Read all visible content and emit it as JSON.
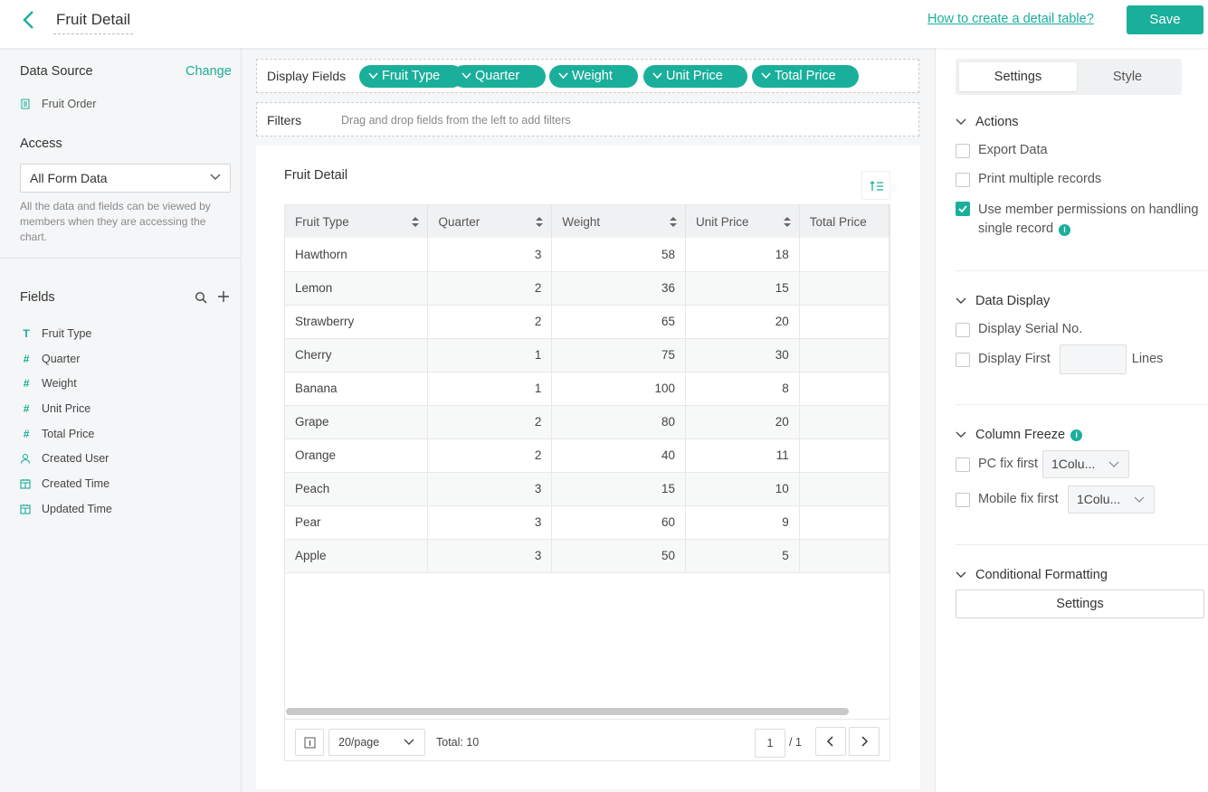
{
  "header": {
    "title": "Fruit Detail",
    "help_link": "How to create a detail table?",
    "save_label": "Save"
  },
  "left": {
    "data_source_label": "Data Source",
    "change_label": "Change",
    "source_name": "Fruit Order",
    "access_label": "Access",
    "access_value": "All Form Data",
    "access_desc": "All the data and fields can be viewed by members when they are accessing the chart.",
    "fields_label": "Fields",
    "fields": [
      {
        "label": "Fruit Type",
        "icon": "text-type-icon",
        "glyph": "T"
      },
      {
        "label": "Quarter",
        "icon": "number-type-icon",
        "glyph": "#"
      },
      {
        "label": "Weight",
        "icon": "number-type-icon",
        "glyph": "#"
      },
      {
        "label": "Unit Price",
        "icon": "number-type-icon",
        "glyph": "#"
      },
      {
        "label": "Total Price",
        "icon": "number-type-icon",
        "glyph": "#"
      },
      {
        "label": "Created User",
        "icon": "user-icon",
        "glyph": ""
      },
      {
        "label": "Created Time",
        "icon": "calendar-icon",
        "glyph": ""
      },
      {
        "label": "Updated Time",
        "icon": "calendar-icon",
        "glyph": ""
      }
    ]
  },
  "middle": {
    "display_fields_label": "Display Fields",
    "display_chips": [
      "Fruit Type",
      "Quarter",
      "Weight",
      "Unit Price",
      "Total Price"
    ],
    "filters_label": "Filters",
    "filters_hint": "Drag and drop fields from the left to add filters",
    "chart_title": "Fruit Detail",
    "columns": [
      "Fruit Type",
      "Quarter",
      "Weight",
      "Unit Price",
      "Total Price"
    ],
    "rows": [
      [
        "Hawthorn",
        "3",
        "58",
        "18",
        ""
      ],
      [
        "Lemon",
        "2",
        "36",
        "15",
        ""
      ],
      [
        "Strawberry",
        "2",
        "65",
        "20",
        ""
      ],
      [
        "Cherry",
        "1",
        "75",
        "30",
        ""
      ],
      [
        "Banana",
        "1",
        "100",
        "8",
        ""
      ],
      [
        "Grape",
        "2",
        "80",
        "20",
        ""
      ],
      [
        "Orange",
        "2",
        "40",
        "11",
        ""
      ],
      [
        "Peach",
        "3",
        "15",
        "10",
        ""
      ],
      [
        "Pear",
        "3",
        "60",
        "9",
        ""
      ],
      [
        "Apple",
        "3",
        "50",
        "5",
        ""
      ]
    ],
    "pager": {
      "page_size": "20/page",
      "total": "Total: 10",
      "page": "1",
      "of": "/ 1"
    }
  },
  "right": {
    "tabs": [
      "Settings",
      "Style"
    ],
    "actions_label": "Actions",
    "export_data": "Export Data",
    "print_multiple": "Print multiple records",
    "member_perm": "Use member permissions on handling single record",
    "data_display_label": "Data Display",
    "serial_no": "Display Serial No.",
    "display_first": "Display First",
    "lines": "Lines",
    "column_freeze_label": "Column Freeze",
    "pc_fix": "PC fix first",
    "pc_fix_value": "1Colu...",
    "mobile_fix": "Mobile fix first",
    "mobile_fix_value": "1Colu...",
    "cond_format_label": "Conditional Formatting",
    "cond_settings": "Settings"
  },
  "colors": {
    "accent": "#1aaf9b"
  }
}
